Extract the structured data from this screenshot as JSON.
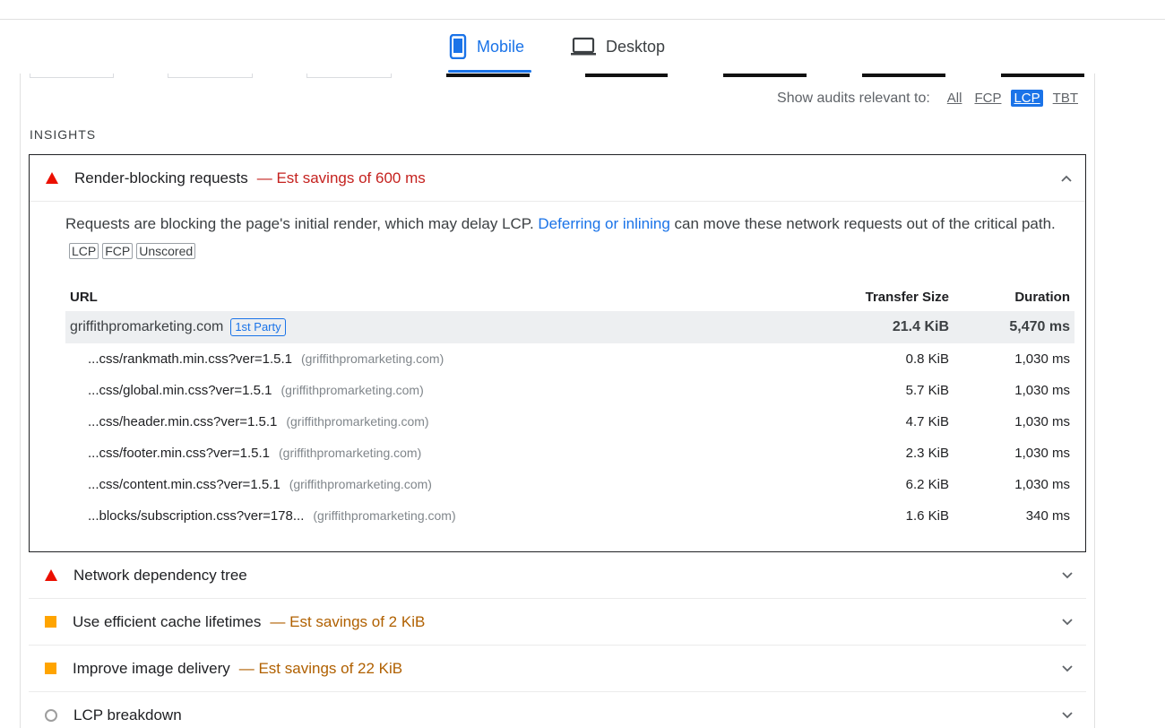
{
  "device_tabs": {
    "mobile_label": "Mobile",
    "desktop_label": "Desktop",
    "mobile_icon": "phone-icon",
    "desktop_icon": "laptop-icon",
    "active": "Mobile"
  },
  "filter": {
    "label": "Show audits relevant to:",
    "chips": [
      "All",
      "FCP",
      "LCP",
      "TBT"
    ],
    "active": "LCP"
  },
  "section_title": "INSIGHTS",
  "audits": [
    {
      "title": "Render-blocking requests",
      "savings": "— Est savings of 600 ms",
      "status": "fail",
      "expanded": true,
      "description_before": "Requests are blocking the page's initial render, which may delay LCP. ",
      "description_link": "Deferring or inlining",
      "description_after": " can move these network requests out of the critical path.",
      "tags": [
        "LCP",
        "FCP",
        "Unscored"
      ],
      "table": {
        "headers": [
          "URL",
          "Transfer Size",
          "Duration"
        ],
        "group": {
          "name": "griffithpromarketing.com",
          "badge": "1st Party",
          "size": "21.4 KiB",
          "duration": "5,470 ms"
        },
        "rows": [
          {
            "url": "...css/rankmath.min.css?ver=1.5.1",
            "host": "(griffithpromarketing.com)",
            "size": "0.8 KiB",
            "duration": "1,030 ms"
          },
          {
            "url": "...css/global.min.css?ver=1.5.1",
            "host": "(griffithpromarketing.com)",
            "size": "5.7 KiB",
            "duration": "1,030 ms"
          },
          {
            "url": "...css/header.min.css?ver=1.5.1",
            "host": "(griffithpromarketing.com)",
            "size": "4.7 KiB",
            "duration": "1,030 ms"
          },
          {
            "url": "...css/footer.min.css?ver=1.5.1",
            "host": "(griffithpromarketing.com)",
            "size": "2.3 KiB",
            "duration": "1,030 ms"
          },
          {
            "url": "...css/content.min.css?ver=1.5.1",
            "host": "(griffithpromarketing.com)",
            "size": "6.2 KiB",
            "duration": "1,030 ms"
          },
          {
            "url": "...blocks/subscription.css?ver=178...",
            "host": "(griffithpromarketing.com)",
            "size": "1.6 KiB",
            "duration": "340 ms"
          }
        ]
      }
    },
    {
      "title": "Network dependency tree",
      "savings": "",
      "status": "fail"
    },
    {
      "title": "Use efficient cache lifetimes",
      "savings": "— Est savings of 2 KiB",
      "status": "average"
    },
    {
      "title": "Improve image delivery",
      "savings": "— Est savings of 22 KiB",
      "status": "average"
    },
    {
      "title": "LCP breakdown",
      "savings": "",
      "status": "info"
    }
  ],
  "colors": {
    "accent": "#1a73e8",
    "fail": "#eb0f00",
    "average": "#ffa400",
    "savings": "#c5221f"
  }
}
